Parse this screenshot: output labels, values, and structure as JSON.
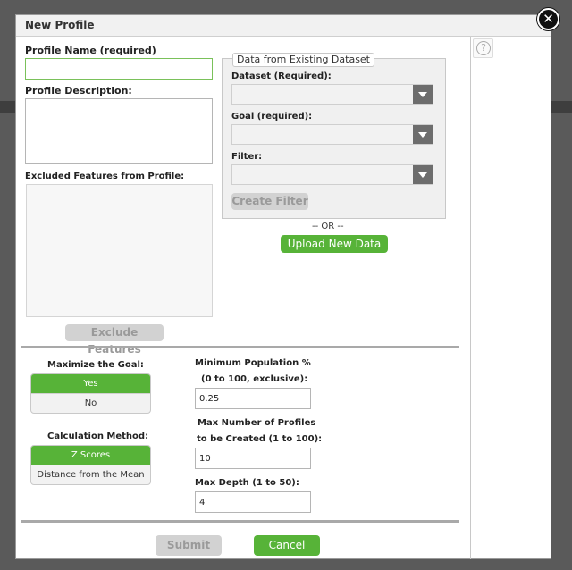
{
  "dialog": {
    "title": "New Profile",
    "close_label": "✕",
    "help_label": "?"
  },
  "profile": {
    "name_label": "Profile Name (required)",
    "name_value": "",
    "description_label": "Profile Description:",
    "description_value": "",
    "excluded_label": "Excluded Features from Profile:",
    "exclude_button": "Exclude Features"
  },
  "dataset_panel": {
    "legend": "Data from Existing Dataset",
    "dataset_label": "Dataset (Required):",
    "dataset_value": "",
    "goal_label": "Goal (required):",
    "goal_value": "",
    "filter_label": "Filter:",
    "filter_value": "",
    "create_filter_button": "Create Filter"
  },
  "or_text": "-- OR --",
  "upload_button": "Upload New Data",
  "options": {
    "maximize_label": "Maximize the Goal:",
    "maximize_options": [
      "Yes",
      "No"
    ],
    "maximize_selected": "Yes",
    "method_label": "Calculation Method:",
    "method_options": [
      "Z Scores",
      "Distance from the Mean"
    ],
    "method_selected": "Z Scores",
    "min_pop_label_1": "Minimum Population %",
    "min_pop_label_2": "(0 to 100, exclusive):",
    "min_pop_value": "0.25",
    "max_profiles_label_1": "Max Number of Profiles",
    "max_profiles_label_2": "to be Created (1 to 100):",
    "max_profiles_value": "10",
    "max_depth_label": "Max Depth (1 to 50):",
    "max_depth_value": "4"
  },
  "footer": {
    "submit_label": "Submit",
    "cancel_label": "Cancel"
  },
  "colors": {
    "accent_green": "#57b338",
    "disabled_gray": "#d2d2d2"
  }
}
